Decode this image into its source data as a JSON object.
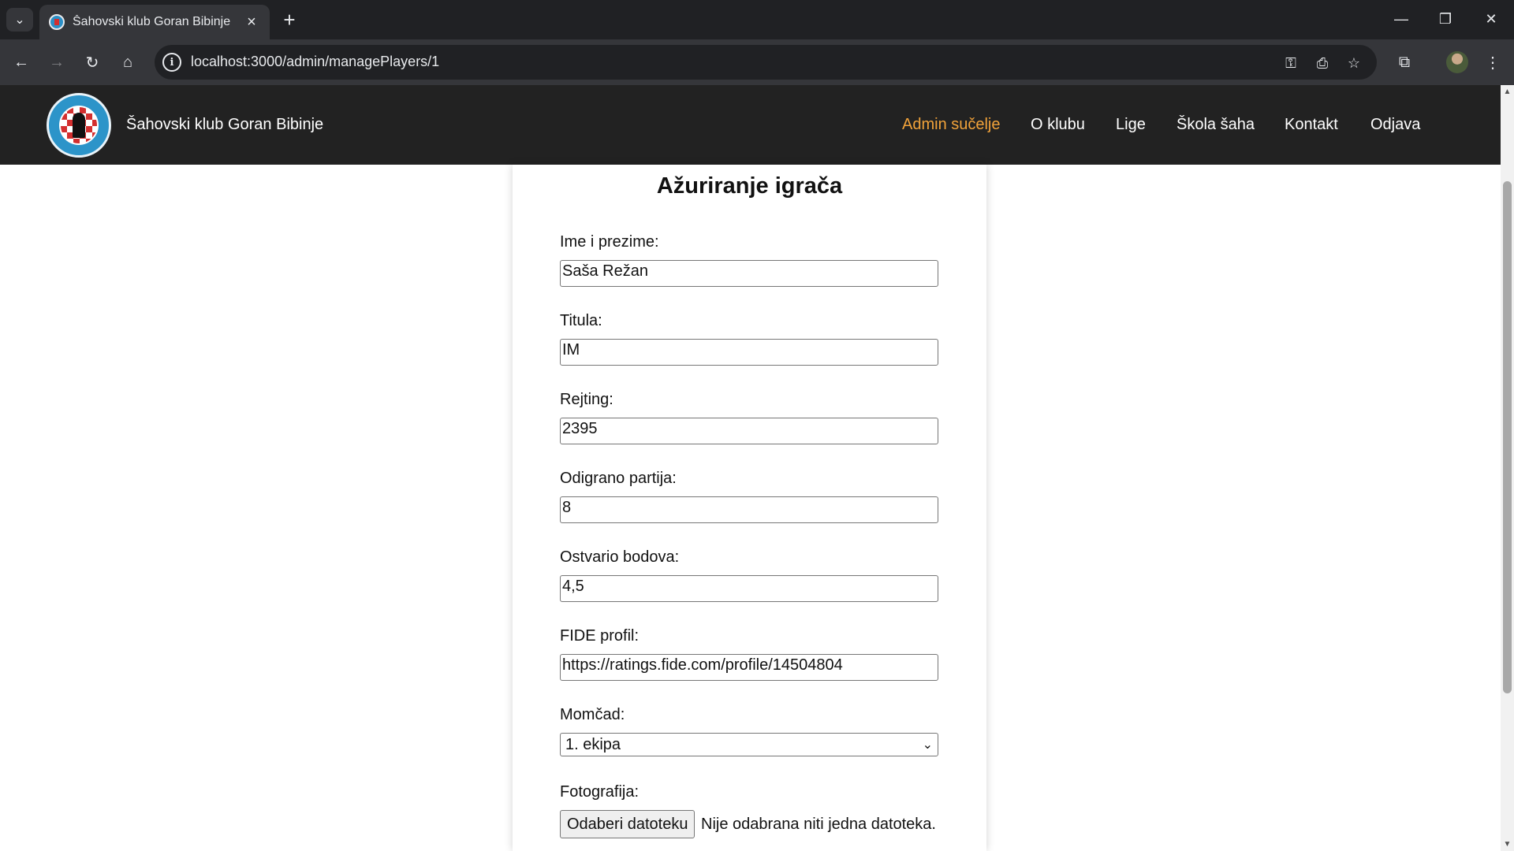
{
  "browser": {
    "tab_title": "Šahovski klub Goran Bibinje",
    "url": "localhost:3000/admin/managePlayers/1"
  },
  "site": {
    "title": "Šahovski klub Goran Bibinje",
    "nav": [
      {
        "label": "Admin sučelje",
        "active": true
      },
      {
        "label": "O klubu",
        "active": false
      },
      {
        "label": "Lige",
        "active": false
      },
      {
        "label": "Škola šaha",
        "active": false
      },
      {
        "label": "Kontakt",
        "active": false
      },
      {
        "label": "Odjava",
        "active": false
      }
    ],
    "accent_color": "#f2a33a"
  },
  "form": {
    "heading": "Ažuriranje igrača",
    "fields": [
      {
        "label": "Ime i prezime:",
        "value": "Saša Režan"
      },
      {
        "label": "Titula:",
        "value": "IM"
      },
      {
        "label": "Rejting:",
        "value": "2395"
      },
      {
        "label": "Odigrano partija:",
        "value": "8"
      },
      {
        "label": "Ostvario bodova:",
        "value": "4,5"
      },
      {
        "label": "FIDE profil:",
        "value": "https://ratings.fide.com/profile/14504804"
      }
    ],
    "team": {
      "label": "Momčad:",
      "selected": "1. ekipa"
    },
    "photo": {
      "label": "Fotografija:",
      "button": "Odaberi datoteku",
      "status": "Nije odabrana niti jedna datoteka."
    }
  }
}
